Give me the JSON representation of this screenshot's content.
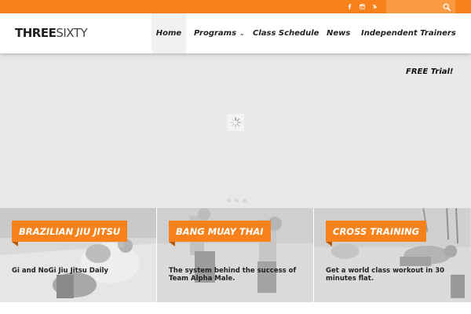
{
  "topbar": {
    "social": [
      {
        "icon": "facebook-icon"
      },
      {
        "icon": "instagram-icon"
      },
      {
        "icon": "youtube-icon"
      }
    ],
    "search": {
      "placeholder": "",
      "value": "",
      "icon": "search-icon"
    },
    "color": "#f7821b"
  },
  "header": {
    "logo": {
      "bold": "THREE",
      "light": "SIXTY"
    },
    "nav": [
      {
        "label": "Home",
        "active": true
      },
      {
        "label": "Programs",
        "dropdown": true
      },
      {
        "label": "Class Schedule"
      },
      {
        "label": "News"
      },
      {
        "label": "Independent Trainers"
      }
    ]
  },
  "hero": {
    "cta": "FREE Trial!",
    "slides_total": 3,
    "loading": true
  },
  "cards": [
    {
      "title": "BRAZILIAN JIU JITSU",
      "description": "Gi and NoGi Jiu Jitsu Daily"
    },
    {
      "title": "BANG MUAY THAI",
      "description": "The system behind the success of Team Alpha Male."
    },
    {
      "title": "CROSS TRAINING",
      "description": "Get a world class workout in 30 minutes flat."
    }
  ],
  "colors": {
    "accent": "#f7821b",
    "hero_bg": "#e8e8e8"
  }
}
